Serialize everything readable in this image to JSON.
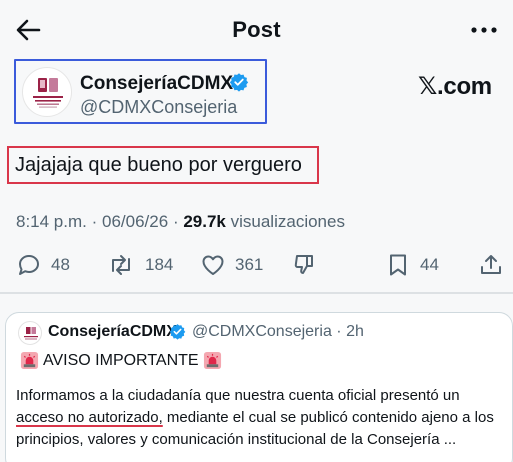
{
  "header": {
    "title": "Post",
    "back_icon": "arrow-left-icon",
    "more_icon": "more-horizontal-icon"
  },
  "post": {
    "author_name": "ConsejeríaCDMX",
    "author_handle": "@CDMXConsejeria",
    "source_label": "𝕏.com",
    "text": "Jajajaja que bueno por verguero",
    "time": "8:14 p.m.",
    "separator": "·",
    "date": "06/06/26",
    "separator2": "·",
    "views_count": "29.7k",
    "views_label": "visualizaciones"
  },
  "actions": {
    "replies": "48",
    "reposts": "184",
    "likes": "361",
    "bookmarks": "44"
  },
  "quote": {
    "author_name": "ConsejeríaCDMX",
    "author_handle": "@CDMXConsejeria",
    "dot": "·",
    "time": "2h",
    "aviso_text": "AVISO IMPORTANTE",
    "body_part1": "Informamos a la ciudadanía que nuestra cuenta oficial presentó un ",
    "body_underlined": "acceso no autorizado,",
    "body_part2": " mediante el cual se publicó contenido ajeno a los principios, valores y comunicación institucional de la Consejería ..."
  },
  "colors": {
    "verified_blue": "#1d9bf0",
    "author_box_border": "#3b5bdb",
    "text_box_border": "#d9364a",
    "muted_text": "#536471"
  }
}
